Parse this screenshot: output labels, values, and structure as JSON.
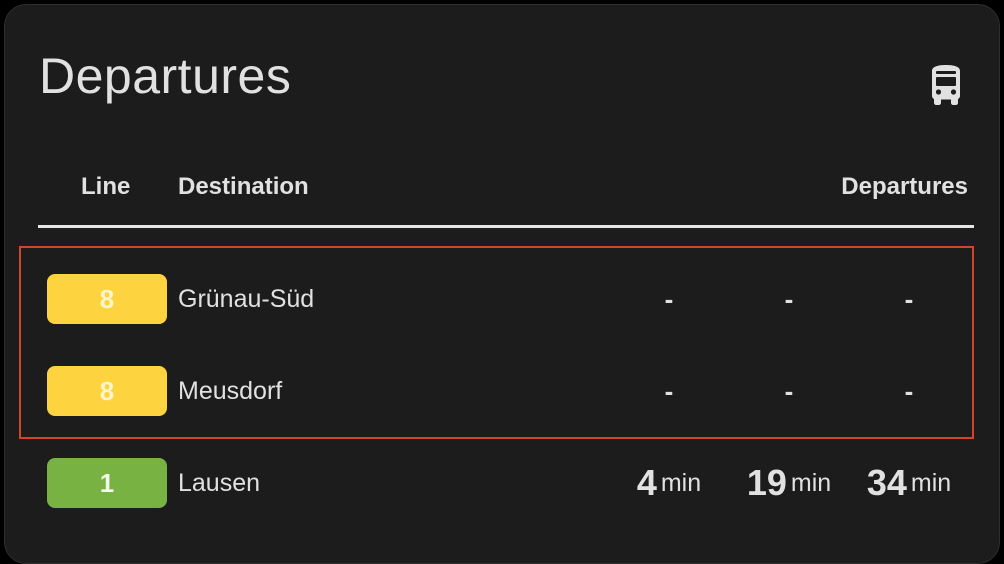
{
  "card": {
    "title": "Departures",
    "icon": "bus-icon"
  },
  "columns": {
    "line": "Line",
    "destination": "Destination",
    "departures": "Departures"
  },
  "colors": {
    "highlight": "#d2452b",
    "line_8": "#fdd33f",
    "line_1": "#77b242"
  },
  "rows": [
    {
      "line": "8",
      "destination": "Grünau-Süd",
      "departures": [
        "-",
        "-",
        "-"
      ]
    },
    {
      "line": "8",
      "destination": "Meusdorf",
      "departures": [
        "-",
        "-",
        "-"
      ]
    },
    {
      "line": "1",
      "destination": "Lausen",
      "departures": [
        {
          "value": "4",
          "unit": "min"
        },
        {
          "value": "19",
          "unit": "min"
        },
        {
          "value": "34",
          "unit": "min"
        }
      ]
    }
  ]
}
